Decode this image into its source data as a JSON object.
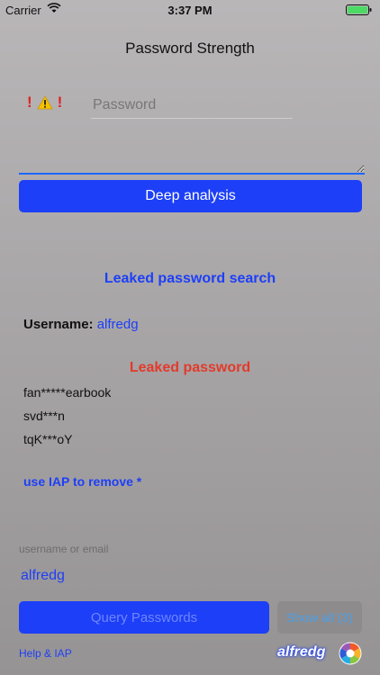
{
  "status_bar": {
    "carrier": "Carrier",
    "time": "3:37 PM"
  },
  "title": "Password Strength",
  "strength": {
    "mark1": "!",
    "mark2": "!"
  },
  "password": {
    "placeholder": "Password",
    "value": ""
  },
  "deep_button": "Deep analysis",
  "leaked_search_title": "Leaked password search",
  "username": {
    "label": "Username:",
    "value": "alfredg"
  },
  "leaked_title": "Leaked password",
  "leaked_passwords": [
    "fan*****earbook",
    "svd***n",
    "tqK***oY"
  ],
  "iap_note": "use IAP to remove *",
  "email": {
    "label": "username or email",
    "value": "alfredg"
  },
  "query_button": "Query Passwords",
  "show_all_button": "Show all (3)",
  "help_link": "Help & IAP",
  "brand": "alfredg",
  "colors": {
    "accent": "#1d3ff7",
    "danger": "#e33a2a",
    "battery": "#4cd964"
  }
}
